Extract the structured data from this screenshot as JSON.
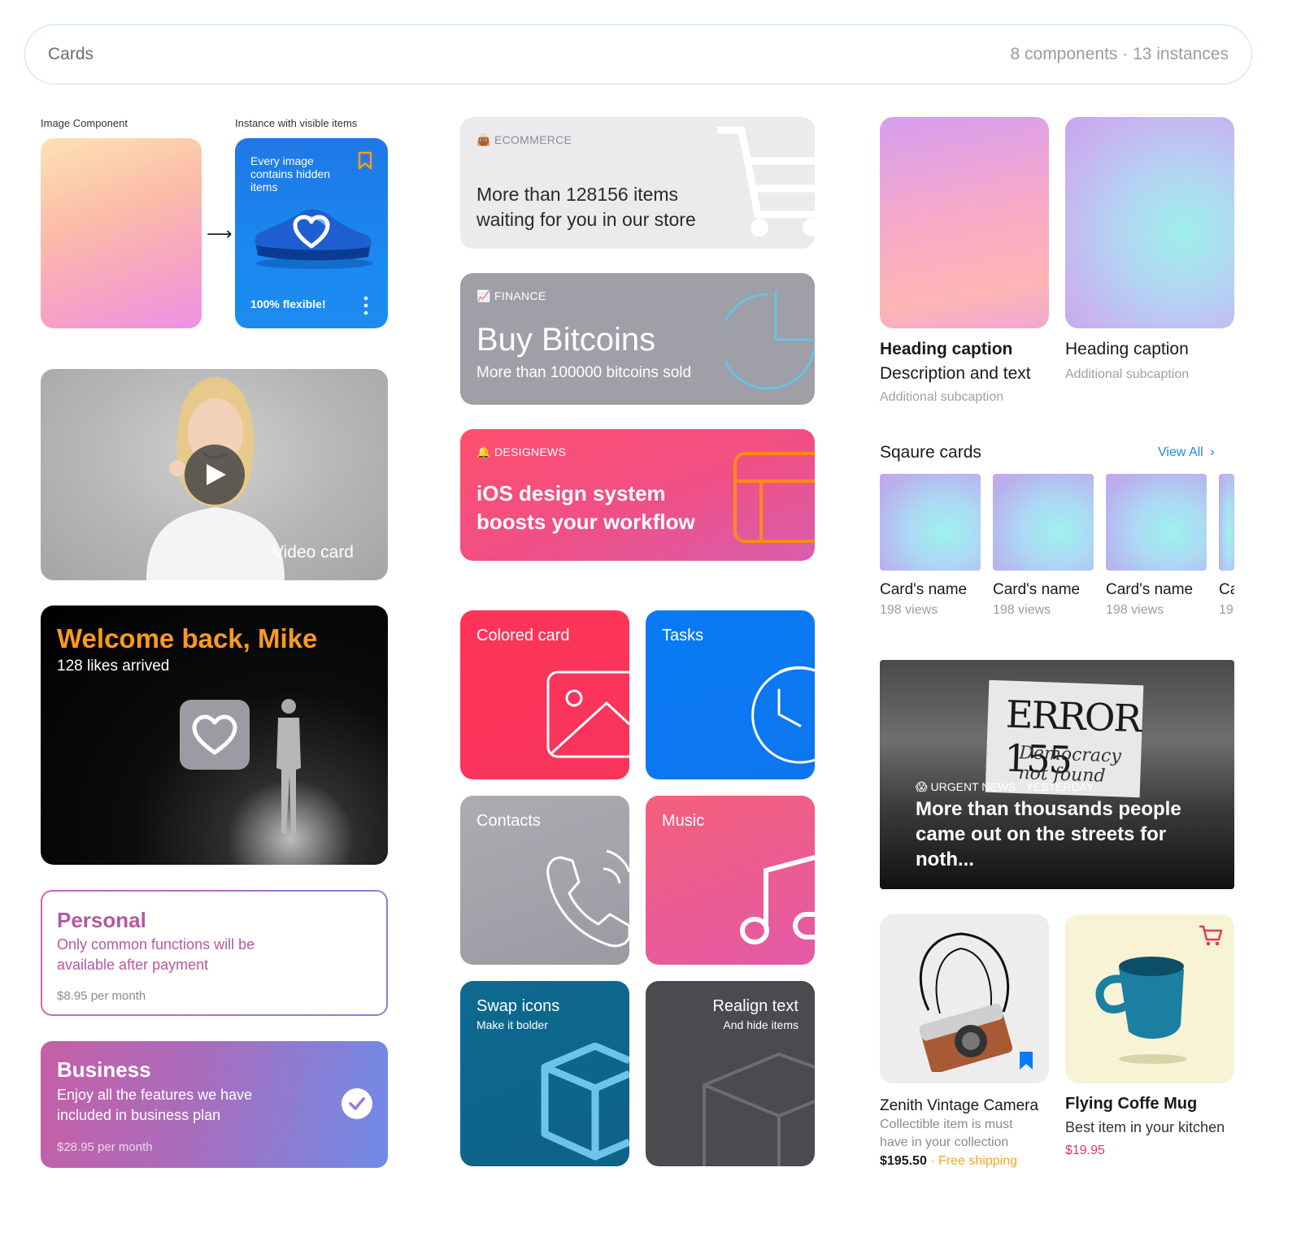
{
  "header": {
    "title": "Cards",
    "counts": "8 components · 13 instances"
  },
  "labels": {
    "image_component": "Image Component",
    "instance_visible": "Instance with visible items"
  },
  "instance_card": {
    "text": "Every image contains hidden items",
    "footer": "100% flexible!"
  },
  "video_card": {
    "label": "Video card"
  },
  "welcome_card": {
    "title": "Welcome back, Mike",
    "subtitle": "128 likes arrived"
  },
  "personal_card": {
    "title": "Personal",
    "description": "Only common functions will be available after payment",
    "price": "$8.95 per month"
  },
  "business_card": {
    "title": "Business",
    "description": "Enjoy all the features we have included in business plan",
    "price": "$28.95 per month"
  },
  "ecommerce_card": {
    "tag": "ECOMMERCE",
    "body": "More than 128156 items waiting for you in our store"
  },
  "finance_card": {
    "tag": "FINANCE",
    "title": "Buy Bitcoins",
    "subtitle": "More than 100000 bitcoins sold"
  },
  "designnews_card": {
    "tag": "DESIGNEWS",
    "body": "iOS design system boosts your workflow"
  },
  "tiles": [
    {
      "title": "Colored card"
    },
    {
      "title": "Tasks"
    },
    {
      "title": "Contacts"
    },
    {
      "title": "Music"
    },
    {
      "title": "Swap icons",
      "subtitle": "Make it bolder"
    },
    {
      "title": "Realign text",
      "subtitle": "And hide items"
    }
  ],
  "caption_cards": [
    {
      "heading": "Heading caption",
      "description": "Description and text",
      "subcaption": "Additional subcaption"
    },
    {
      "heading": "Heading caption",
      "subcaption": "Additional subcaption"
    }
  ],
  "square_cards": {
    "title": "Sqaure cards",
    "view_all": "View All",
    "items": [
      {
        "name": "Card's name",
        "views": "198 views"
      },
      {
        "name": "Card's name",
        "views": "198 views"
      },
      {
        "name": "Card's name",
        "views": "198 views"
      },
      {
        "name": "Ca",
        "views": "19"
      }
    ]
  },
  "news_card": {
    "sign_title": "ERROR 155",
    "sign_text": "Democracy not found",
    "tag": "URGENT NEWS · YESTERDAY",
    "body": "More than thousands people came out on the streets for noth..."
  },
  "products": [
    {
      "name": "Zenith Vintage Camera",
      "description": "Collectible item is must have in your collection",
      "price": "$195.50",
      "shipping": "· Free shipping"
    },
    {
      "name": "Flying Coffe Mug",
      "description": "Best item in your kitchen",
      "price": "$19.95"
    }
  ],
  "colors": {
    "accent_blue": "#1e88e5",
    "orange": "#ff9a1a",
    "red": "#e23a5a",
    "purple": "#b4599e"
  }
}
